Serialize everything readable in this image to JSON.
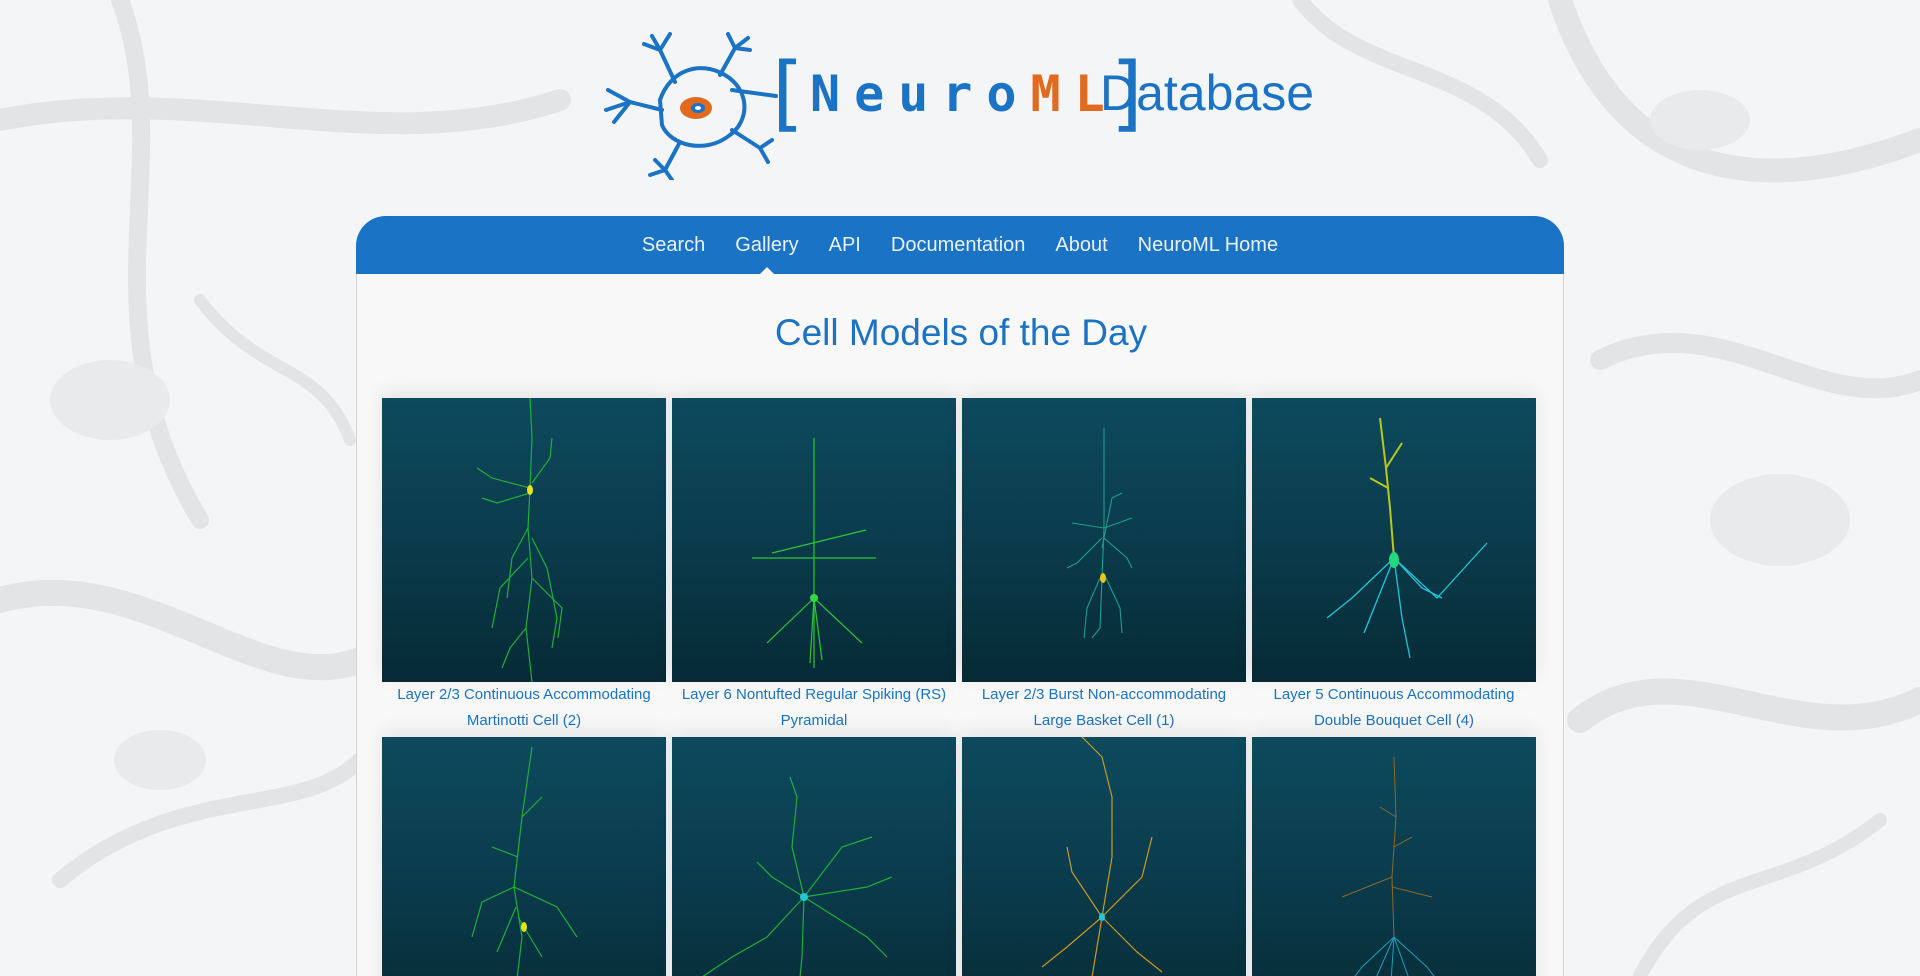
{
  "header": {
    "logo_bracket_open": "[",
    "logo_neuro": "Neuro",
    "logo_ml": "ML",
    "logo_bracket_close": "]",
    "logo_database": "Database"
  },
  "nav": {
    "items": [
      {
        "label": "Search"
      },
      {
        "label": "Gallery"
      },
      {
        "label": "API"
      },
      {
        "label": "Documentation"
      },
      {
        "label": "About"
      },
      {
        "label": "NeuroML Home"
      }
    ],
    "active": "Gallery"
  },
  "main": {
    "title": "Cell Models of the Day",
    "cells": [
      {
        "caption": "Layer 2/3 Continuous Accommodating Martinotti Cell (2)",
        "palette": "green-yellow"
      },
      {
        "caption": "Layer 6 Nontufted Regular Spiking (RS) Pyramidal",
        "palette": "green"
      },
      {
        "caption": "Layer 2/3 Burst Non-accommodating Large Basket Cell (1)",
        "palette": "teal-yellow"
      },
      {
        "caption": "Layer 5 Continuous Accommodating Double Bouquet Cell (4)",
        "palette": "yellow-cyan"
      },
      {
        "caption": "",
        "palette": "green-yellow"
      },
      {
        "caption": "",
        "palette": "green-cyan"
      },
      {
        "caption": "",
        "palette": "orange-cyan"
      },
      {
        "caption": "",
        "palette": "orange-cyan-dim"
      }
    ]
  },
  "colors": {
    "brand_blue": "#1a73c4",
    "brand_orange": "#e06a1e",
    "thumb_bg": "#0a3a4a"
  }
}
